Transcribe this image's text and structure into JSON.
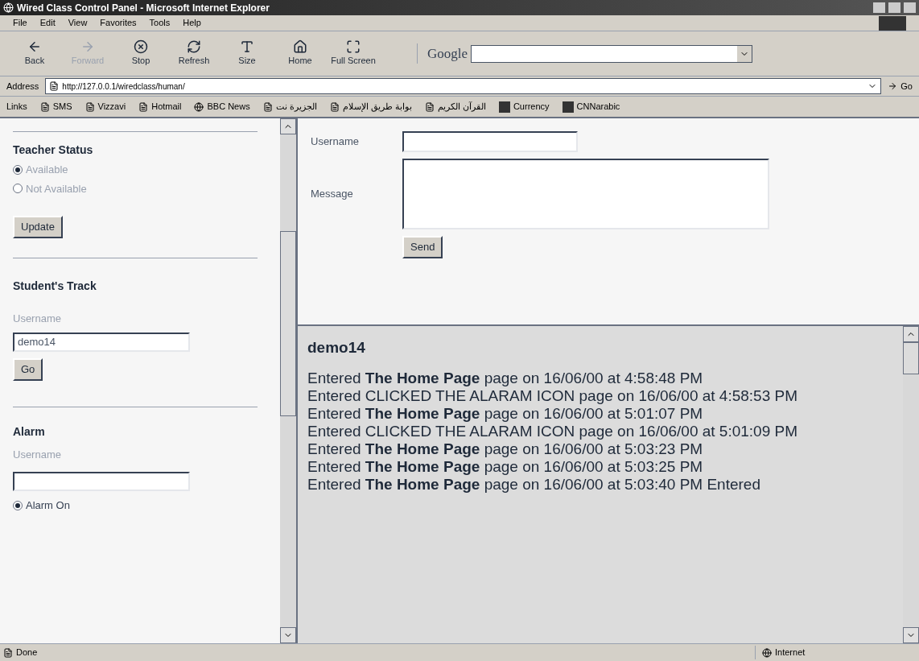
{
  "window": {
    "title": "Wired Class Control Panel - Microsoft Internet Explorer"
  },
  "menu": [
    "File",
    "Edit",
    "View",
    "Favorites",
    "Tools",
    "Help"
  ],
  "toolbar": [
    {
      "kind": "back",
      "label": "Back",
      "disabled": false
    },
    {
      "kind": "forward",
      "label": "Forward",
      "disabled": true
    },
    {
      "kind": "stop",
      "label": "Stop",
      "disabled": false
    },
    {
      "kind": "refresh",
      "label": "Refresh",
      "disabled": false
    },
    {
      "kind": "size",
      "label": "Size",
      "disabled": false
    },
    {
      "kind": "home",
      "label": "Home",
      "disabled": false
    },
    {
      "kind": "fullscreen",
      "label": "Full Screen",
      "disabled": false
    }
  ],
  "search": {
    "label": "Google"
  },
  "address": {
    "label": "Address",
    "value": "http://127.0.0.1/wiredclass/human/",
    "go": "Go"
  },
  "links": {
    "label": "Links",
    "items": [
      {
        "kind": "page",
        "label": "SMS"
      },
      {
        "kind": "page",
        "label": "Vizzavi"
      },
      {
        "kind": "page",
        "label": "Hotmail"
      },
      {
        "kind": "news",
        "label": "BBC News"
      },
      {
        "kind": "page",
        "label": "الجزيرة نت"
      },
      {
        "kind": "page",
        "label": "بوابة طريق الإسلام"
      },
      {
        "kind": "page",
        "label": "القرآن الكريم"
      },
      {
        "kind": "tile",
        "label": "Currency"
      },
      {
        "kind": "tile",
        "label": "CNNarabic"
      }
    ]
  },
  "sidebar": {
    "teacher_status": {
      "title": "Teacher Status",
      "options": [
        {
          "label": "Available",
          "selected": true
        },
        {
          "label": "Not Available",
          "selected": false
        }
      ],
      "button": "Update"
    },
    "students_track": {
      "title": "Student's Track",
      "username_label": "Username",
      "username_value": "demo14",
      "button": "Go"
    },
    "alarm": {
      "title": "Alarm",
      "username_label": "Username",
      "options": [
        {
          "label": "Alarm On",
          "selected": true
        }
      ]
    }
  },
  "message_form": {
    "username_label": "Username",
    "message_label": "Message",
    "button": "Send"
  },
  "log": {
    "user": "demo14",
    "lines": [
      "Entered **The Home Page** page on 16/06/00 at 4:58:48 PM",
      "Entered CLICKED THE ALARAM ICON page on 16/06/00 at 4:58:53 PM",
      "Entered **The Home Page** page on 16/06/00 at 5:01:07 PM",
      "Entered CLICKED THE ALARAM ICON page on 16/06/00 at 5:01:09 PM",
      "Entered **The Home Page** page on 16/06/00 at 5:03:23 PM",
      "Entered **The Home Page** page on 16/06/00 at 5:03:25 PM",
      "Entered **The Home Page** page on 16/06/00 at 5:03:40 PM Entered"
    ]
  },
  "status_bar": {
    "text": "Done",
    "zone": "Internet"
  }
}
